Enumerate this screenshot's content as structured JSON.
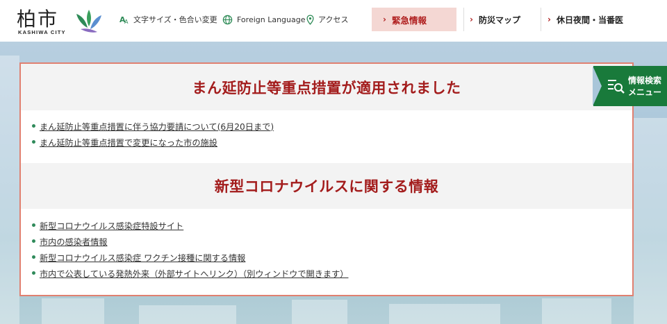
{
  "header": {
    "logo_main": "柏市",
    "logo_sub": "KASHIWA CITY",
    "util_links": [
      {
        "label": "文字サイズ・色合い変更",
        "icon": "text-size-icon"
      },
      {
        "label": "Foreign Language",
        "icon": "globe-icon"
      },
      {
        "label": "アクセス",
        "icon": "map-pin-icon"
      }
    ],
    "emergency_label": "緊急情報",
    "nav": [
      {
        "label": "防災マップ"
      },
      {
        "label": "休日夜間・当番医"
      }
    ]
  },
  "side_menu": {
    "line1": "情報検索",
    "line2": "メニュー",
    "icon": "search-menu-icon"
  },
  "sections": [
    {
      "title": "まん延防止等重点措置が適用されました",
      "links": [
        "まん延防止等重点措置に伴う協力要請について(6月20日まで)",
        "まん延防止等重点措置で変更になった市の施設"
      ]
    },
    {
      "title": "新型コロナウイルスに関する情報",
      "links": [
        "新型コロナウイルス感染症特設サイト",
        "市内の感染者情報",
        "新型コロナウイルス感染症 ワクチン接種に関する情報",
        "市内で公表している発熱外来（外部サイトへリンク）（別ウィンドウで開きます）"
      ]
    }
  ],
  "colors": {
    "accent_red": "#a31c1c",
    "emergency_bg": "#f4d7d3",
    "panel_border": "#e08070",
    "bullet_green": "#2f8a5a",
    "side_tab_green": "#197a3b"
  }
}
